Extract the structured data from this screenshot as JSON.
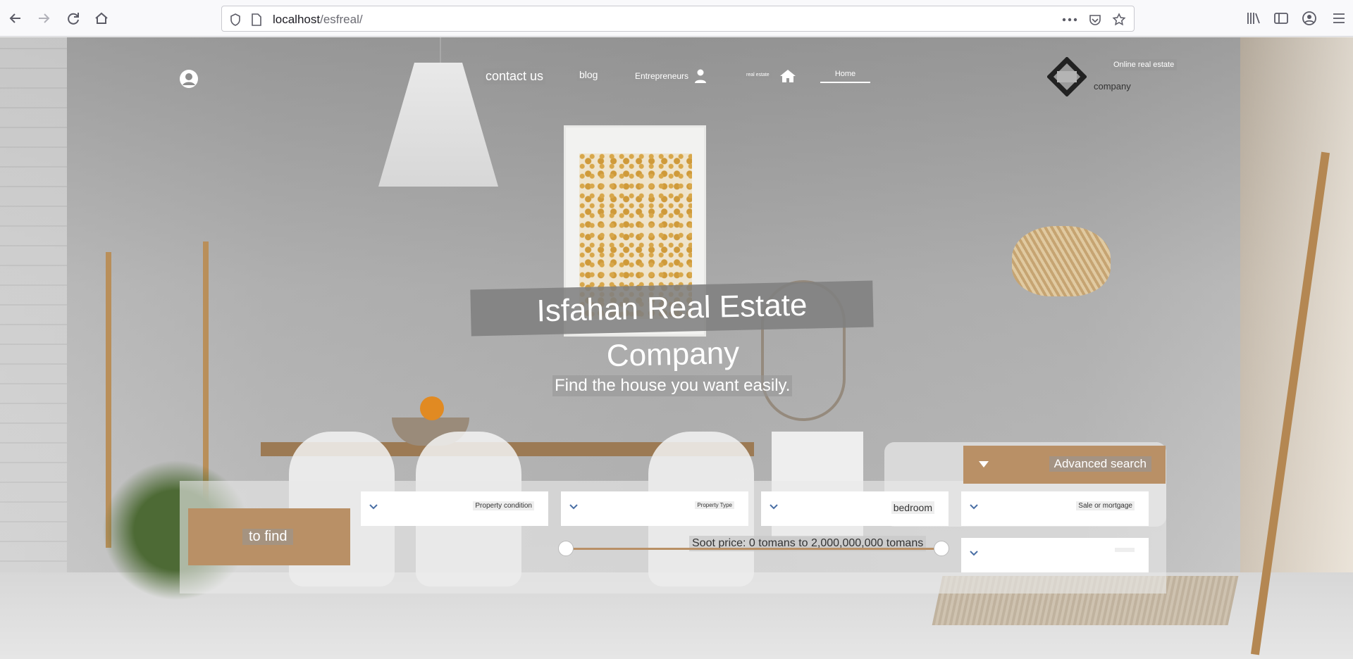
{
  "browser": {
    "url_host": "localhost",
    "url_path": "/esfreal/"
  },
  "nav": {
    "contact": "contact us",
    "blog": "blog",
    "entrepreneurs": "Entrepreneurs",
    "real_estate": "real estate",
    "home": "Home"
  },
  "logo": {
    "top": "Online real estate",
    "bottom": "company"
  },
  "hero": {
    "title": "Isfahan Real Estate Company",
    "subtitle": "Find the house you want easily."
  },
  "search": {
    "advanced": "Advanced search",
    "find": "to find",
    "property_condition": "Property condition",
    "property_type": "Property Type",
    "bedroom": "bedroom",
    "sale_mortgage": "Sale or mortgage",
    "extra_select": "",
    "price_range": "Soot price: 0 tomans to 2,000,000,000 tomans"
  },
  "colors": {
    "accent": "#b99066",
    "overlay": "#808080"
  }
}
